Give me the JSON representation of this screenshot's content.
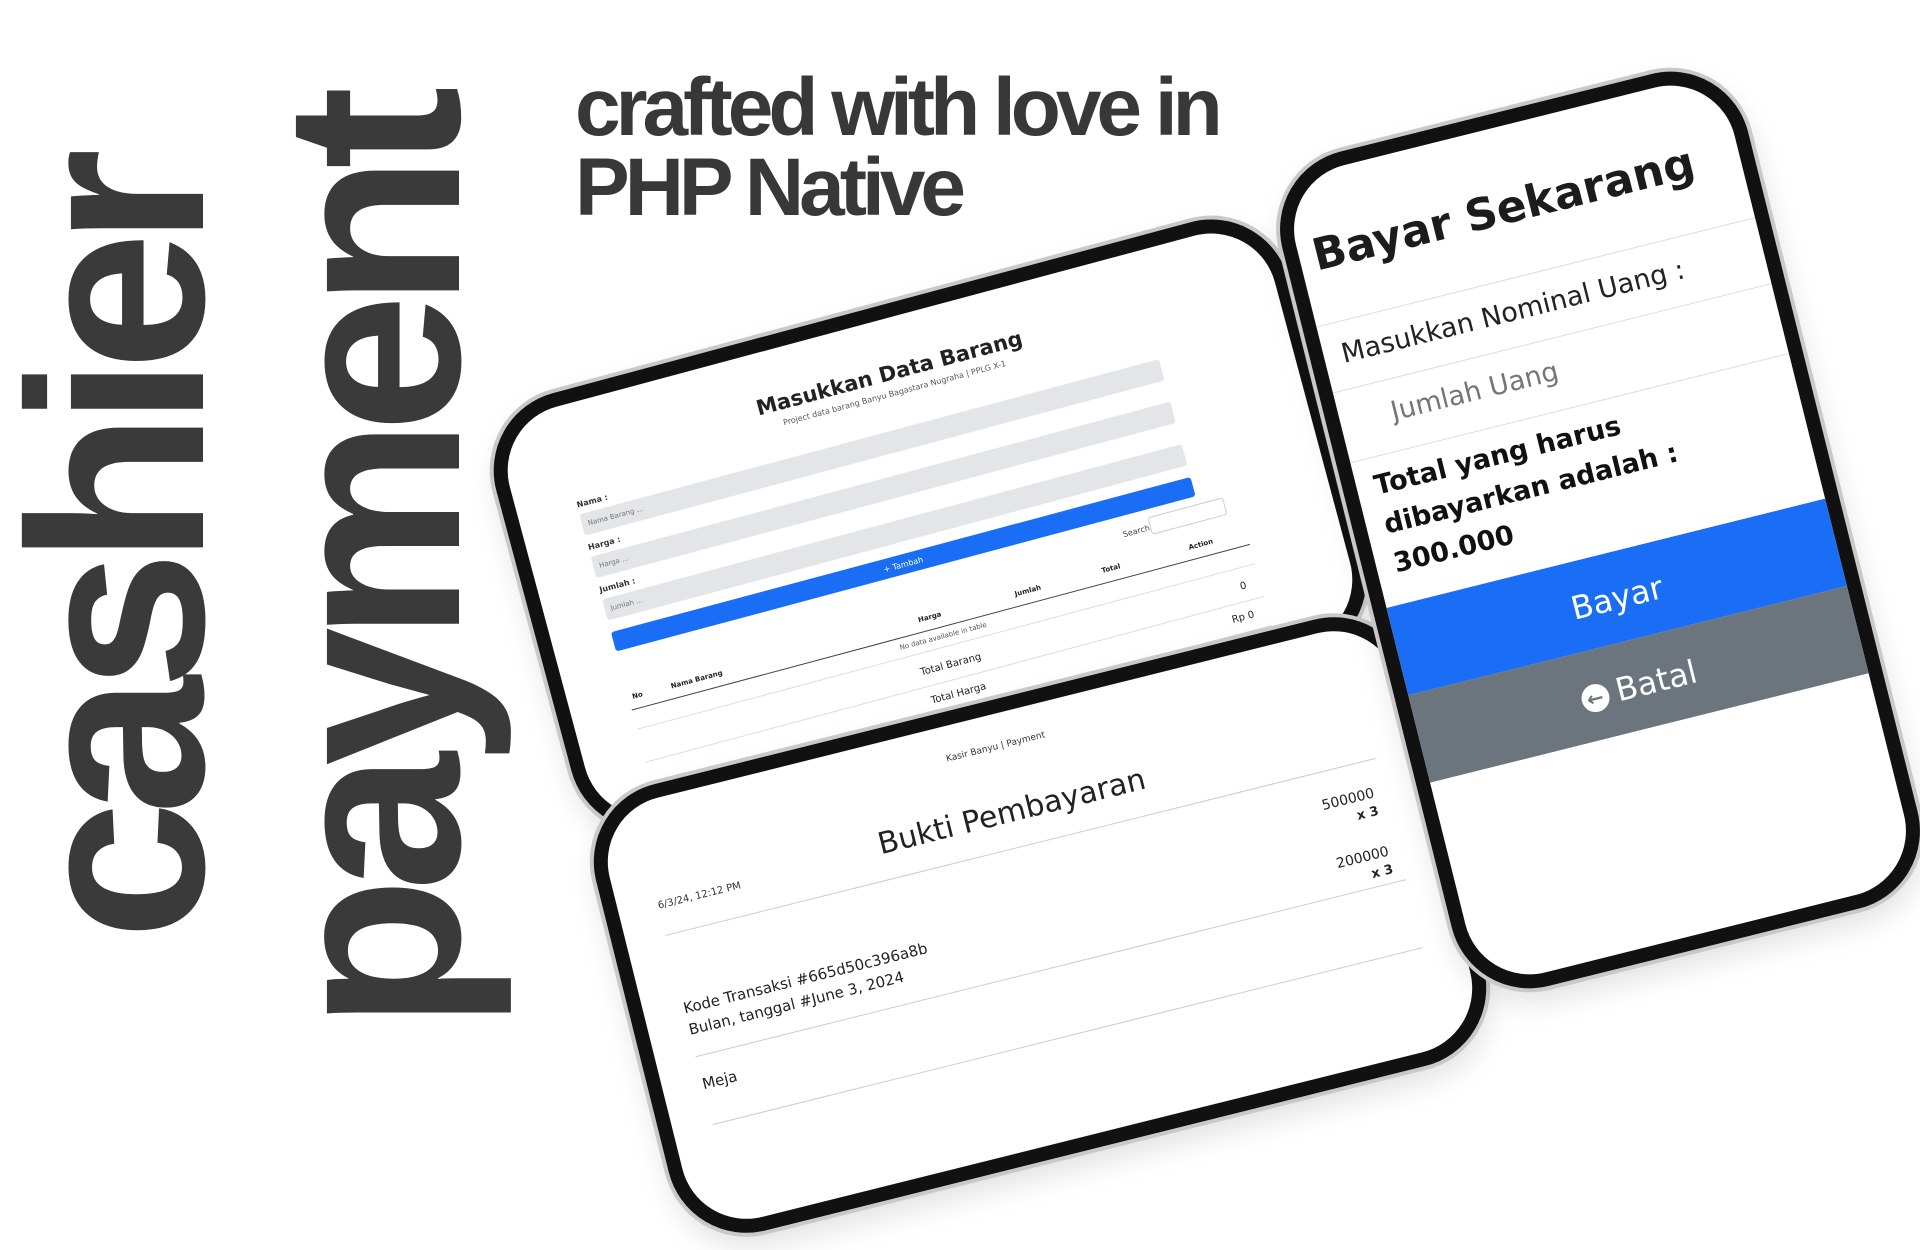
{
  "headline": {
    "word1": "cashier",
    "word2": "payment"
  },
  "tagline": {
    "line1": "crafted with love in",
    "line2": "PHP Native"
  },
  "form_screen": {
    "title": "Masukkan Data Barang",
    "subtitle": "Project data barang Banyu Bagastara Nugraha | PPLG X-1",
    "name_label": "Nama :",
    "name_placeholder": "Nama Barang ...",
    "price_label": "Harga :",
    "price_placeholder": "Harga ...",
    "qty_label": "Jumlah :",
    "qty_placeholder": "Jumlah ...",
    "add_button": "+ Tambah",
    "search_label": "Search:",
    "columns": [
      "No",
      "Nama Barang",
      "Harga",
      "Jumlah",
      "Total",
      "Action"
    ],
    "empty_text": "No data available in table",
    "total_items_label": "Total Barang",
    "total_items_value": "0",
    "total_price_label": "Total Harga",
    "total_price_value": "Rp 0"
  },
  "receipt_screen": {
    "header": "Kasir Banyu | Payment",
    "datetime": "6/3/24, 12:12 PM",
    "title": "Bukti Pembayaran",
    "transaction_code": "Kode Transaksi #665d50c396a8b",
    "date_line": "Bulan, tanggal #June 3, 2024",
    "table_label": "Meja",
    "items": [
      {
        "price": "500000",
        "qty": "x 3"
      },
      {
        "price": "200000",
        "qty": "x 3"
      }
    ]
  },
  "pay_screen": {
    "title": "Bayar Sekarang",
    "nominal_label": "Masukkan Nominal Uang :",
    "amount_placeholder": "Jumlah Uang",
    "total_text": "Total yang harus dibayarkan adalah : 300.000",
    "pay_button": "Bayar",
    "cancel_button": "Batal"
  },
  "colors": {
    "primary": "#1a6ef5",
    "secondary": "#6c757d",
    "headline": "#3a3a3a"
  }
}
